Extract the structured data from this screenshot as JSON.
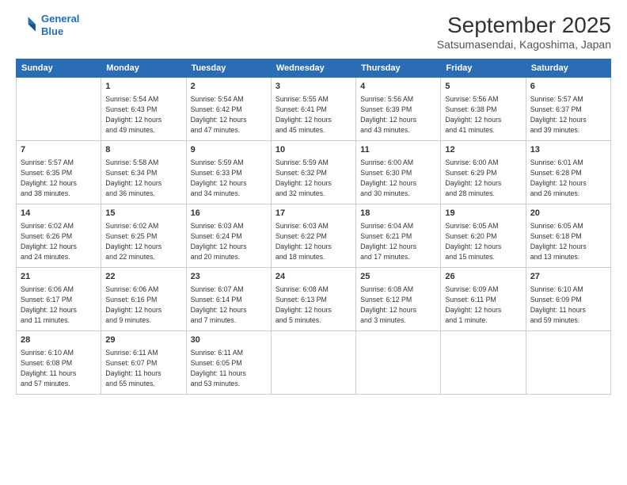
{
  "header": {
    "logo_line1": "General",
    "logo_line2": "Blue",
    "month_title": "September 2025",
    "subtitle": "Satsumasendai, Kagoshima, Japan"
  },
  "weekdays": [
    "Sunday",
    "Monday",
    "Tuesday",
    "Wednesday",
    "Thursday",
    "Friday",
    "Saturday"
  ],
  "weeks": [
    [
      {
        "day": "",
        "info": ""
      },
      {
        "day": "1",
        "info": "Sunrise: 5:54 AM\nSunset: 6:43 PM\nDaylight: 12 hours\nand 49 minutes."
      },
      {
        "day": "2",
        "info": "Sunrise: 5:54 AM\nSunset: 6:42 PM\nDaylight: 12 hours\nand 47 minutes."
      },
      {
        "day": "3",
        "info": "Sunrise: 5:55 AM\nSunset: 6:41 PM\nDaylight: 12 hours\nand 45 minutes."
      },
      {
        "day": "4",
        "info": "Sunrise: 5:56 AM\nSunset: 6:39 PM\nDaylight: 12 hours\nand 43 minutes."
      },
      {
        "day": "5",
        "info": "Sunrise: 5:56 AM\nSunset: 6:38 PM\nDaylight: 12 hours\nand 41 minutes."
      },
      {
        "day": "6",
        "info": "Sunrise: 5:57 AM\nSunset: 6:37 PM\nDaylight: 12 hours\nand 39 minutes."
      }
    ],
    [
      {
        "day": "7",
        "info": "Sunrise: 5:57 AM\nSunset: 6:35 PM\nDaylight: 12 hours\nand 38 minutes."
      },
      {
        "day": "8",
        "info": "Sunrise: 5:58 AM\nSunset: 6:34 PM\nDaylight: 12 hours\nand 36 minutes."
      },
      {
        "day": "9",
        "info": "Sunrise: 5:59 AM\nSunset: 6:33 PM\nDaylight: 12 hours\nand 34 minutes."
      },
      {
        "day": "10",
        "info": "Sunrise: 5:59 AM\nSunset: 6:32 PM\nDaylight: 12 hours\nand 32 minutes."
      },
      {
        "day": "11",
        "info": "Sunrise: 6:00 AM\nSunset: 6:30 PM\nDaylight: 12 hours\nand 30 minutes."
      },
      {
        "day": "12",
        "info": "Sunrise: 6:00 AM\nSunset: 6:29 PM\nDaylight: 12 hours\nand 28 minutes."
      },
      {
        "day": "13",
        "info": "Sunrise: 6:01 AM\nSunset: 6:28 PM\nDaylight: 12 hours\nand 26 minutes."
      }
    ],
    [
      {
        "day": "14",
        "info": "Sunrise: 6:02 AM\nSunset: 6:26 PM\nDaylight: 12 hours\nand 24 minutes."
      },
      {
        "day": "15",
        "info": "Sunrise: 6:02 AM\nSunset: 6:25 PM\nDaylight: 12 hours\nand 22 minutes."
      },
      {
        "day": "16",
        "info": "Sunrise: 6:03 AM\nSunset: 6:24 PM\nDaylight: 12 hours\nand 20 minutes."
      },
      {
        "day": "17",
        "info": "Sunrise: 6:03 AM\nSunset: 6:22 PM\nDaylight: 12 hours\nand 18 minutes."
      },
      {
        "day": "18",
        "info": "Sunrise: 6:04 AM\nSunset: 6:21 PM\nDaylight: 12 hours\nand 17 minutes."
      },
      {
        "day": "19",
        "info": "Sunrise: 6:05 AM\nSunset: 6:20 PM\nDaylight: 12 hours\nand 15 minutes."
      },
      {
        "day": "20",
        "info": "Sunrise: 6:05 AM\nSunset: 6:18 PM\nDaylight: 12 hours\nand 13 minutes."
      }
    ],
    [
      {
        "day": "21",
        "info": "Sunrise: 6:06 AM\nSunset: 6:17 PM\nDaylight: 12 hours\nand 11 minutes."
      },
      {
        "day": "22",
        "info": "Sunrise: 6:06 AM\nSunset: 6:16 PM\nDaylight: 12 hours\nand 9 minutes."
      },
      {
        "day": "23",
        "info": "Sunrise: 6:07 AM\nSunset: 6:14 PM\nDaylight: 12 hours\nand 7 minutes."
      },
      {
        "day": "24",
        "info": "Sunrise: 6:08 AM\nSunset: 6:13 PM\nDaylight: 12 hours\nand 5 minutes."
      },
      {
        "day": "25",
        "info": "Sunrise: 6:08 AM\nSunset: 6:12 PM\nDaylight: 12 hours\nand 3 minutes."
      },
      {
        "day": "26",
        "info": "Sunrise: 6:09 AM\nSunset: 6:11 PM\nDaylight: 12 hours\nand 1 minute."
      },
      {
        "day": "27",
        "info": "Sunrise: 6:10 AM\nSunset: 6:09 PM\nDaylight: 11 hours\nand 59 minutes."
      }
    ],
    [
      {
        "day": "28",
        "info": "Sunrise: 6:10 AM\nSunset: 6:08 PM\nDaylight: 11 hours\nand 57 minutes."
      },
      {
        "day": "29",
        "info": "Sunrise: 6:11 AM\nSunset: 6:07 PM\nDaylight: 11 hours\nand 55 minutes."
      },
      {
        "day": "30",
        "info": "Sunrise: 6:11 AM\nSunset: 6:05 PM\nDaylight: 11 hours\nand 53 minutes."
      },
      {
        "day": "",
        "info": ""
      },
      {
        "day": "",
        "info": ""
      },
      {
        "day": "",
        "info": ""
      },
      {
        "day": "",
        "info": ""
      }
    ]
  ]
}
